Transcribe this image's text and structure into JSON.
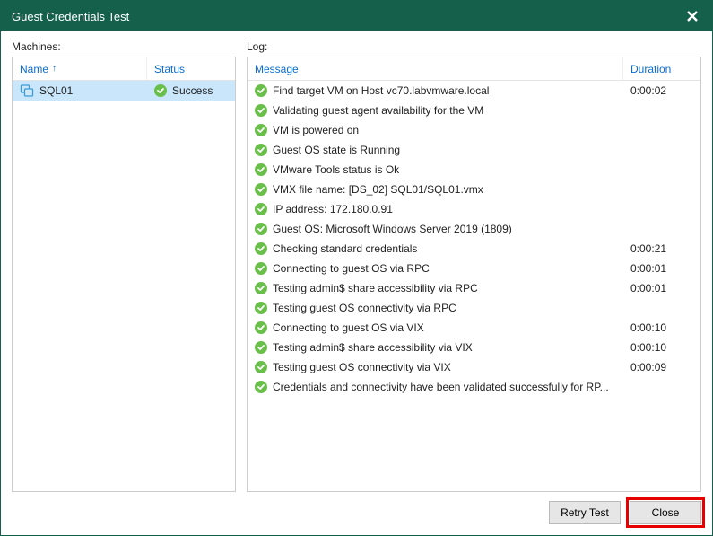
{
  "window": {
    "title": "Guest Credentials Test"
  },
  "labels": {
    "machines": "Machines:",
    "log": "Log:"
  },
  "machines": {
    "headers": {
      "name": "Name",
      "status": "Status"
    },
    "rows": [
      {
        "name": "SQL01",
        "status": "Success"
      }
    ]
  },
  "log": {
    "headers": {
      "message": "Message",
      "duration": "Duration"
    },
    "rows": [
      {
        "msg": "Find target VM on Host vc70.labvmware.local",
        "dur": "0:00:02"
      },
      {
        "msg": "Validating guest agent availability for the VM",
        "dur": ""
      },
      {
        "msg": "VM is powered on",
        "dur": ""
      },
      {
        "msg": "Guest OS state is Running",
        "dur": ""
      },
      {
        "msg": "VMware Tools status is Ok",
        "dur": ""
      },
      {
        "msg": "VMX file name: [DS_02] SQL01/SQL01.vmx",
        "dur": ""
      },
      {
        "msg": "IP address: 172.180.0.91",
        "dur": ""
      },
      {
        "msg": "Guest OS: Microsoft Windows Server 2019 (1809)",
        "dur": ""
      },
      {
        "msg": "Checking standard credentials",
        "dur": "0:00:21"
      },
      {
        "msg": "Connecting to guest OS via RPC",
        "dur": "0:00:01"
      },
      {
        "msg": "Testing admin$ share accessibility via RPC",
        "dur": "0:00:01"
      },
      {
        "msg": "Testing guest OS connectivity via RPC",
        "dur": ""
      },
      {
        "msg": "Connecting to guest OS via VIX",
        "dur": "0:00:10"
      },
      {
        "msg": "Testing admin$ share accessibility via VIX",
        "dur": "0:00:10"
      },
      {
        "msg": "Testing guest OS connectivity via VIX",
        "dur": "0:00:09"
      },
      {
        "msg": "Credentials and connectivity have been validated successfully for RP...",
        "dur": ""
      }
    ]
  },
  "buttons": {
    "retry": "Retry Test",
    "close": "Close"
  }
}
